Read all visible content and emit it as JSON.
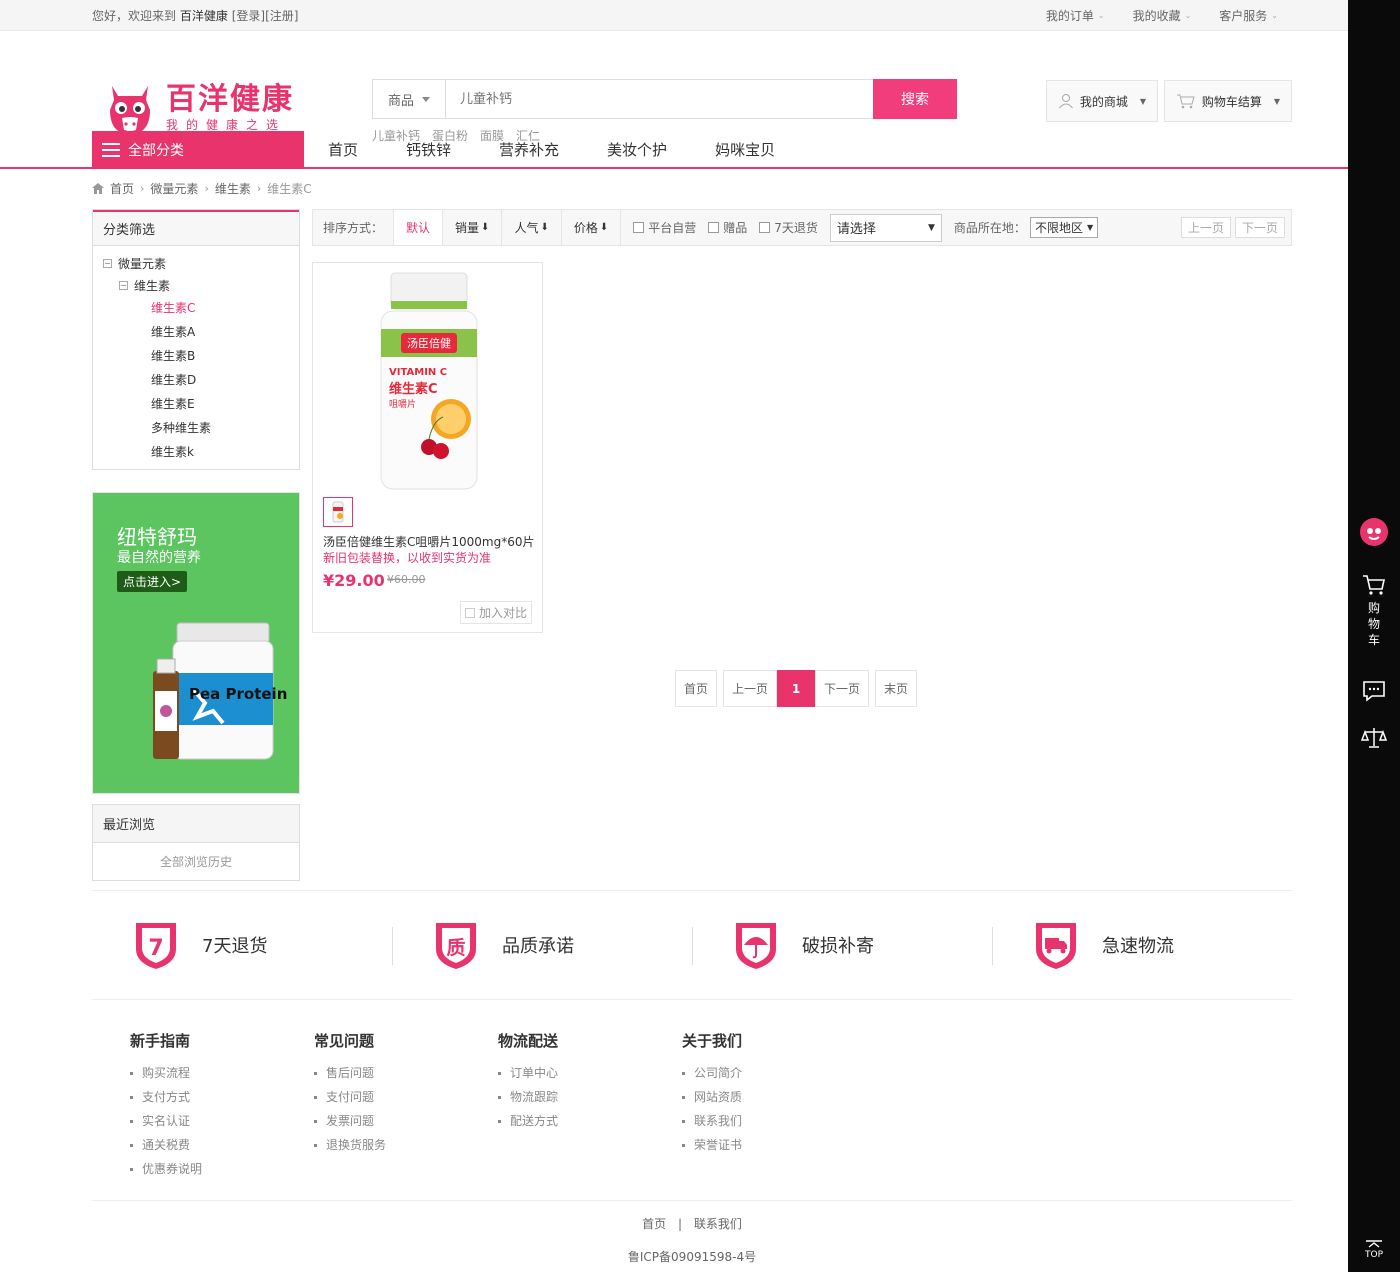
{
  "topbar": {
    "greeting": "您好，欢迎来到",
    "site": "百洋健康",
    "login": "[登录]",
    "register": "[注册]",
    "links": [
      "我的订单",
      "我的收藏",
      "客户服务"
    ]
  },
  "logo": {
    "name": "百洋健康",
    "slogan": "我的健康之选"
  },
  "search": {
    "category": "商品",
    "placeholder": "儿童补钙",
    "button": "搜索",
    "hot": [
      "儿童补钙",
      "蛋白粉",
      "面膜",
      "汇仁"
    ]
  },
  "header_buttons": {
    "mymall": "我的商城",
    "cart": "购物车结算"
  },
  "nav": {
    "all": "全部分类",
    "links": [
      "首页",
      "钙铁锌",
      "营养补充",
      "美妆个护",
      "妈咪宝贝"
    ]
  },
  "breadcrumb": [
    "首页",
    "微量元素",
    "维生素",
    "维生素C"
  ],
  "sidebar": {
    "title": "分类筛选",
    "tree": [
      {
        "label": "微量元素",
        "level": 0,
        "box": "−"
      },
      {
        "label": "维生素",
        "level": 1,
        "box": "−"
      },
      {
        "label": "维生素C",
        "level": 2,
        "active": true
      },
      {
        "label": "维生素A",
        "level": 2
      },
      {
        "label": "维生素B",
        "level": 2
      },
      {
        "label": "维生素D",
        "level": 2
      },
      {
        "label": "维生素E",
        "level": 2
      },
      {
        "label": "多种维生素",
        "level": 2
      },
      {
        "label": "维生素k",
        "level": 2
      }
    ],
    "promo": {
      "title": "纽特舒玛",
      "subtitle": "最自然的营养",
      "button": "点击进入>",
      "product_text": "Pea Protein"
    },
    "recent": {
      "title": "最近浏览",
      "history": "全部浏览历史"
    }
  },
  "filter": {
    "label": "排序方式：",
    "sorts": [
      "默认",
      "销量",
      "人气",
      "价格"
    ],
    "checks": [
      "平台自营",
      "赠品",
      "7天退货"
    ],
    "select": "请选择",
    "location_label": "商品所在地：",
    "location": "不限地区",
    "prev": "上一页",
    "next": "下一页"
  },
  "product": {
    "title": "汤臣倍健维生素C咀嚼片1000mg*60片",
    "subtitle": "新旧包装替换，以收到实货为准",
    "price": "¥29.00",
    "original": "¥60.00",
    "compare": "加入对比",
    "label_brand": "汤臣倍健",
    "label_en": "VITAMIN C",
    "label_cn": "维生素C",
    "label_type": "咀嚼片"
  },
  "pager": [
    "首页",
    "上一页",
    "1",
    "下一页",
    "末页"
  ],
  "guarantees": [
    "7天退货",
    "品质承诺",
    "破损补寄",
    "急速物流"
  ],
  "guarantee_glyphs": [
    "7",
    "质"
  ],
  "footer": {
    "columns": [
      {
        "title": "新手指南",
        "items": [
          "购买流程",
          "支付方式",
          "实名认证",
          "通关税费",
          "优惠券说明"
        ]
      },
      {
        "title": "常见问题",
        "items": [
          "售后问题",
          "支付问题",
          "发票问题",
          "退换货服务"
        ]
      },
      {
        "title": "物流配送",
        "items": [
          "订单中心",
          "物流跟踪",
          "配送方式"
        ]
      },
      {
        "title": "关于我们",
        "items": [
          "公司简介",
          "网站资质",
          "联系我们",
          "荣誉证书"
        ]
      }
    ],
    "bottom_links": [
      "首页",
      "联系我们"
    ],
    "icp": "鲁ICP备09091598-4号"
  },
  "rightbar": {
    "cart": "购物车",
    "top": "TOP"
  },
  "colors": {
    "accent": "#e8336d",
    "search_button": "#f23d7d",
    "promo_bg": "#5cc560"
  }
}
